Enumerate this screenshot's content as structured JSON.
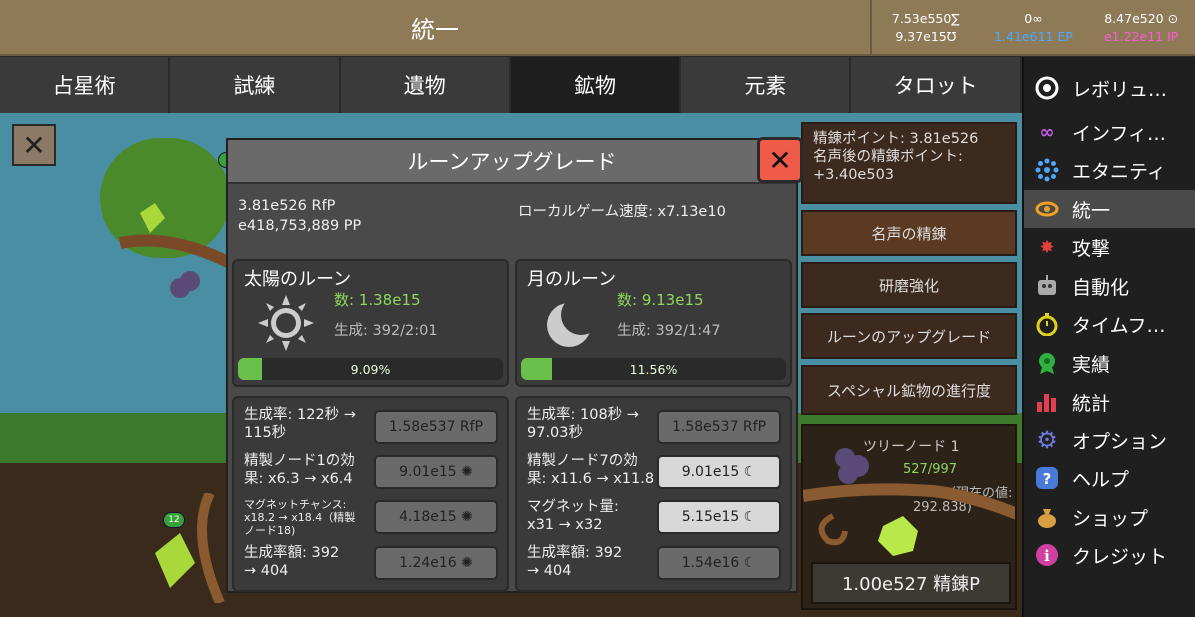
{
  "header": {
    "title": "統一"
  },
  "resources": [
    {
      "top": "7.53e550∑",
      "bottom": "9.37e15Ʊ"
    },
    {
      "top": "0∞",
      "bottom": "1.41e611 EP"
    },
    {
      "top": "8.47e520 ⊙",
      "bottom": "e1.22e11 IP"
    }
  ],
  "tabs": [
    "占星術",
    "試練",
    "遺物",
    "鉱物",
    "元素",
    "タロット"
  ],
  "active_tab": "鉱物",
  "sidebar": {
    "items": [
      {
        "label": "レボリュ…",
        "icon": "revolution-icon",
        "color": "#ffffff"
      },
      {
        "label": "インフィ…",
        "icon": "infinity-icon",
        "color": "#c060e0"
      },
      {
        "label": "エタニティ",
        "icon": "eternity-icon",
        "color": "#4aa8ff"
      },
      {
        "label": "統一",
        "icon": "unity-icon",
        "color": "#f0a020",
        "active": true
      },
      {
        "label": "攻撃",
        "icon": "attack-icon",
        "color": "#e04040"
      },
      {
        "label": "自動化",
        "icon": "robot-icon",
        "color": "#aaaaaa"
      },
      {
        "label": "タイムフ…",
        "icon": "stopwatch-icon",
        "color": "#e0d020"
      },
      {
        "label": "実績",
        "icon": "medal-icon",
        "color": "#30b040"
      },
      {
        "label": "統計",
        "icon": "bar-chart-icon",
        "color": "#e04050"
      },
      {
        "label": "オプション",
        "icon": "gear-icon",
        "color": "#6a7ad8"
      },
      {
        "label": "ヘルプ",
        "icon": "help-icon",
        "color": "#4a7ad8"
      },
      {
        "label": "ショップ",
        "icon": "money-bag-icon",
        "color": "#d8a040"
      },
      {
        "label": "クレジット",
        "icon": "info-icon",
        "color": "#d040a0"
      }
    ]
  },
  "side_panel": {
    "refine_points": "精錬ポイント: 3.81e526",
    "after_prestige": "名声後の精錬ポイント:",
    "after_prestige_value": "+3.40e503",
    "buttons": [
      "名声の精錬",
      "研磨強化",
      "ルーンのアップグレード",
      "スペシャル鉱物の進行度"
    ]
  },
  "tree_node": {
    "title": "ツリーノード 1",
    "count": "527/997",
    "current_note": "（現在の値:",
    "current_value": "292.838)",
    "refine_button": "1.00e527 精錬P",
    "badge_left": "12"
  },
  "modal": {
    "title": "ルーンアップグレード",
    "rfp": "3.81e526 RfP",
    "pp": "e418,753,889 PP",
    "speed": "ローカルゲーム速度: x7.13e10",
    "runes": [
      {
        "name": "太陽のルーン",
        "count": "数: 1.38e15",
        "gen": "生成: 392/2:01",
        "progress_label": "9.09%",
        "progress": 9.09,
        "icon": "sun-icon",
        "upgrades": [
          {
            "label": "生成率: 122秒 →",
            "label2": "115秒",
            "cost": "1.58e537 RfP"
          },
          {
            "label": "精製ノード1の効",
            "label2": "果: x6.3 → x6.4",
            "cost": "9.01e15 ✺"
          },
          {
            "label": "マグネットチャンス:",
            "label2": "x18.2 → x18.4（精製",
            "label3": "ノード18)",
            "cost": "4.18e15 ✺"
          },
          {
            "label": "生成率額: 392",
            "label2": "→ 404",
            "cost": "1.24e16 ✺"
          }
        ]
      },
      {
        "name": "月のルーン",
        "count": "数: 9.13e15",
        "gen": "生成: 392/1:47",
        "progress_label": "11.56%",
        "progress": 11.56,
        "icon": "moon-icon",
        "upgrades": [
          {
            "label": "生成率: 108秒 →",
            "label2": "97.03秒",
            "cost": "1.58e537 RfP"
          },
          {
            "label": "精製ノード7の効",
            "label2": "果: x11.6 → x11.8",
            "cost": "9.01e15 ☾"
          },
          {
            "label": "マグネット量:",
            "label2": "x31 → x32",
            "cost": "5.15e15 ☾"
          },
          {
            "label": "生成率額: 392",
            "label2": "→ 404",
            "cost": "1.54e16 ☾"
          }
        ]
      }
    ]
  }
}
